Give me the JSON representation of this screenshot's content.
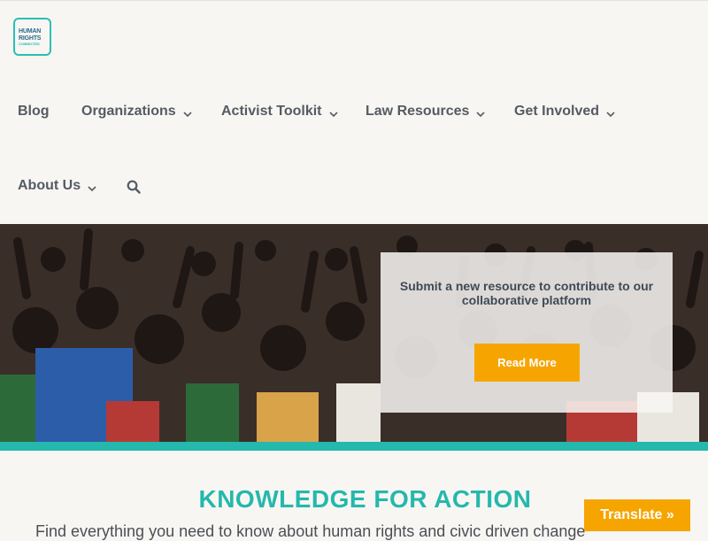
{
  "logo": {
    "line1": "HUMAN",
    "line2": "RIGHTS",
    "line3": "CONNECTED"
  },
  "nav": {
    "blog": "Blog",
    "organizations": "Organizations",
    "activist_toolkit": "Activist Toolkit",
    "law_resources": "Law Resources",
    "get_involved": "Get Involved",
    "about_us": "About Us"
  },
  "hero": {
    "text": "Submit a new resource to contribute to our collaborative platform",
    "button": "Read More"
  },
  "section": {
    "title": "KNOWLEDGE FOR ACTION",
    "subtitle": "Find everything you need to know about human rights and civic driven change"
  },
  "translate": "Translate »",
  "colors": {
    "teal": "#25b8ac",
    "orange": "#f6a500",
    "nav_text": "#545b63"
  }
}
